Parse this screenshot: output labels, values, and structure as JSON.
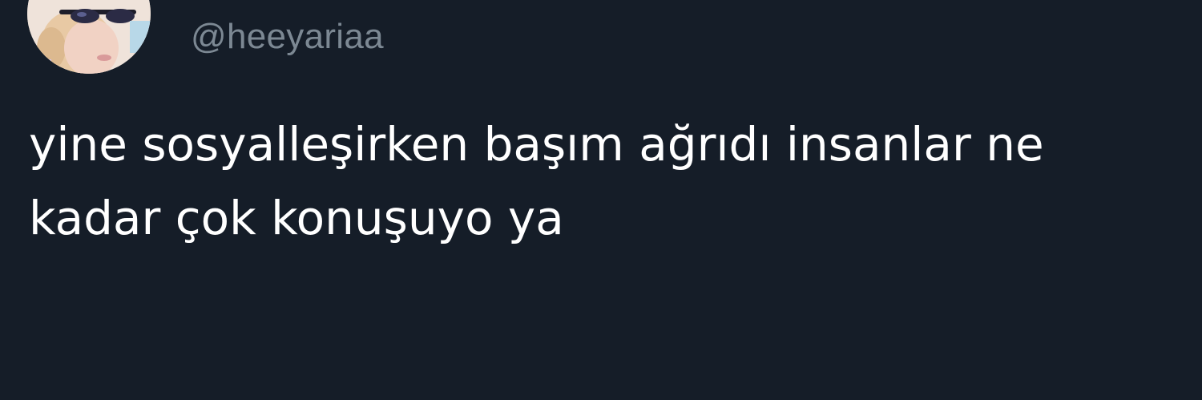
{
  "tweet": {
    "handle": "@heeyariaa",
    "text_lines": [
      "yine sosyalleşirken başım ağrıdı insanlar ne",
      "kadar çok konuşuyo ya"
    ],
    "avatar_icon": "profile-photo-avatar"
  },
  "colors": {
    "background": "#151d28",
    "text": "#ffffff",
    "handle": "#7c8893"
  }
}
